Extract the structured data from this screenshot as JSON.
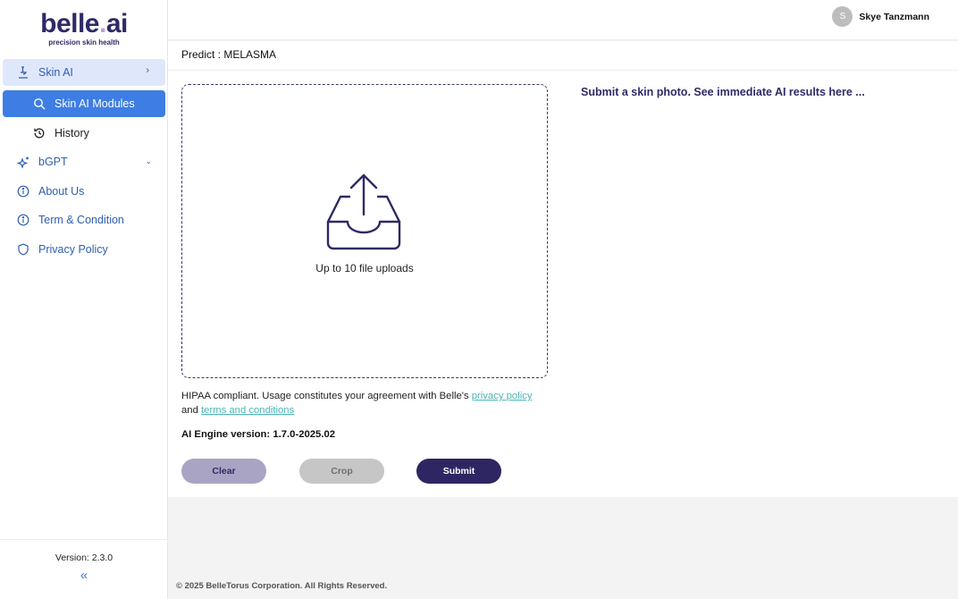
{
  "brand": {
    "name_main": "belle",
    "name_dot": ".",
    "name_tld": "ai",
    "tagline": "precision skin health"
  },
  "sidebar": {
    "items": [
      {
        "label": "Skin AI",
        "icon": "microscope-icon"
      },
      {
        "label": "Skin AI Modules",
        "icon": "search-icon"
      },
      {
        "label": "History",
        "icon": "history-icon"
      },
      {
        "label": "bGPT",
        "icon": "sparkle-icon"
      },
      {
        "label": "About Us",
        "icon": "info-icon"
      },
      {
        "label": "Term & Condition",
        "icon": "info-icon"
      },
      {
        "label": "Privacy Policy",
        "icon": "shield-icon"
      }
    ],
    "version": "Version: 2.3.0",
    "collapse_glyph": "«"
  },
  "header": {
    "avatar_initial": "S",
    "user_name": "Skye Tanzmann"
  },
  "main": {
    "predict_label": "Predict : MELASMA",
    "upload_text": "Up to 10 file uploads",
    "hipaa_prefix": "HIPAA compliant. Usage constitutes your agreement with Belle's ",
    "privacy_link": "privacy policy",
    "hipaa_and": "and ",
    "terms_link": "terms and conditions",
    "engine_version": "AI Engine version: 1.7.0-2025.02",
    "buttons": {
      "clear": "Clear",
      "crop": "Crop",
      "submit": "Submit"
    },
    "result_hint": "Submit a skin photo. See immediate AI results here ..."
  },
  "footer": {
    "copyright": "© 2025 BelleTorus Corporation. All Rights Reserved."
  },
  "colors": {
    "brand": "#2e2a66",
    "accent": "#3d7de4",
    "link": "#4ab4b4",
    "submit": "#2e2563"
  }
}
